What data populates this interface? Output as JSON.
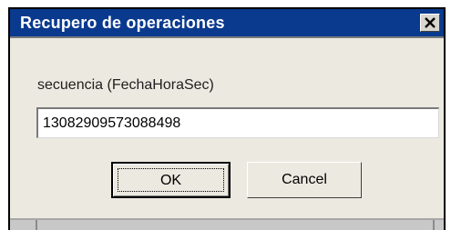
{
  "dialog": {
    "title": "Recupero de operaciones",
    "close_icon": "close-icon"
  },
  "form": {
    "label": "secuencia (FechaHoraSec)",
    "value": "13082909573088498"
  },
  "buttons": {
    "ok_label": "OK",
    "cancel_label": "Cancel"
  },
  "colors": {
    "titlebar": "#0a3a8e",
    "dialog_bg": "#ece9e1"
  }
}
